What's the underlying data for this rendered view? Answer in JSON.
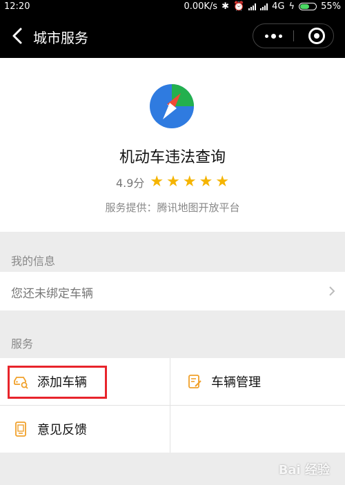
{
  "status_bar": {
    "time": "12:20",
    "network_speed": "0.00K/s",
    "network_type": "4G",
    "battery": "55%"
  },
  "nav": {
    "title": "城市服务",
    "back_icon": "chevron-left-icon",
    "menu_icon": "more-dots-icon",
    "close_icon": "target-close-icon"
  },
  "app": {
    "name": "机动车违法查询",
    "rating": "4.9分",
    "stars": 5,
    "provider": "服务提供：腾讯地图开放平台"
  },
  "my_info": {
    "section_title": "我的信息",
    "vehicle_status": "您还未绑定车辆"
  },
  "services": {
    "section_title": "服务",
    "items": [
      {
        "label": "添加车辆",
        "icon": "car-search-icon"
      },
      {
        "label": "车辆管理",
        "icon": "edit-document-icon"
      },
      {
        "label": "意见反馈",
        "icon": "feedback-card-icon"
      }
    ]
  },
  "watermark": "Bai 经验",
  "colors": {
    "accent_orange": "#f0a02a",
    "highlight_red": "#e8242b",
    "star": "#f5b400"
  }
}
